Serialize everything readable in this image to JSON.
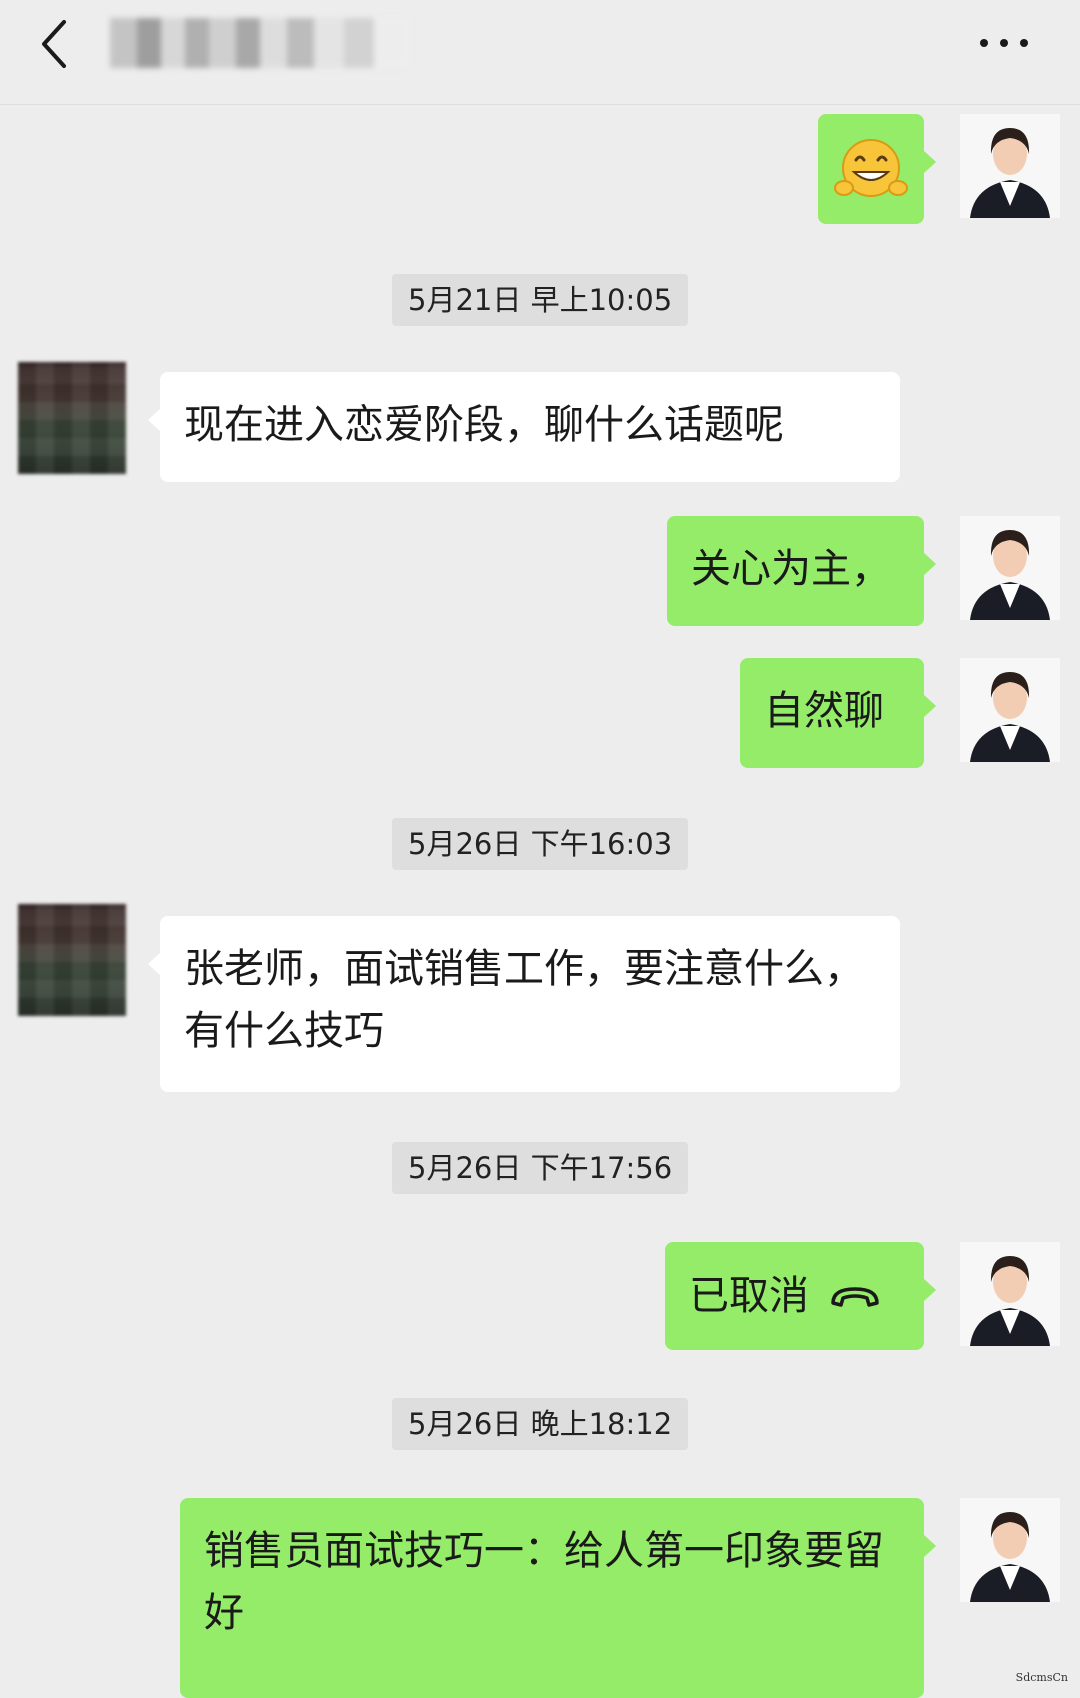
{
  "header": {
    "contact_name": "▓▓▓▓▓▓"
  },
  "messages": [
    {
      "sender": "me",
      "type": "emoji",
      "icon": "grinning-face-with-hands-icon"
    },
    {
      "type": "timestamp",
      "text": "5月21日 早上10:05"
    },
    {
      "sender": "other",
      "type": "text",
      "text": "现在进入恋爱阶段，聊什么话题呢"
    },
    {
      "sender": "me",
      "type": "text",
      "text": "关心为主，"
    },
    {
      "sender": "me",
      "type": "text",
      "text": "自然聊"
    },
    {
      "type": "timestamp",
      "text": "5月26日 下午16:03"
    },
    {
      "sender": "other",
      "type": "text",
      "text": "张老师，面试销售工作，要注意什么，有什么技巧"
    },
    {
      "type": "timestamp",
      "text": "5月26日 下午17:56"
    },
    {
      "sender": "me",
      "type": "call",
      "text": "已取消",
      "icon": "phone-hangup-icon"
    },
    {
      "type": "timestamp",
      "text": "5月26日 晚上18:12"
    },
    {
      "sender": "me",
      "type": "text",
      "text": "销售员面试技巧一：给人第一印象要留好"
    }
  ],
  "watermark": "SdcmsCn",
  "colors": {
    "background": "#ededed",
    "my_bubble": "#95ec69",
    "their_bubble": "#ffffff",
    "timestamp_bg": "#dedede"
  }
}
